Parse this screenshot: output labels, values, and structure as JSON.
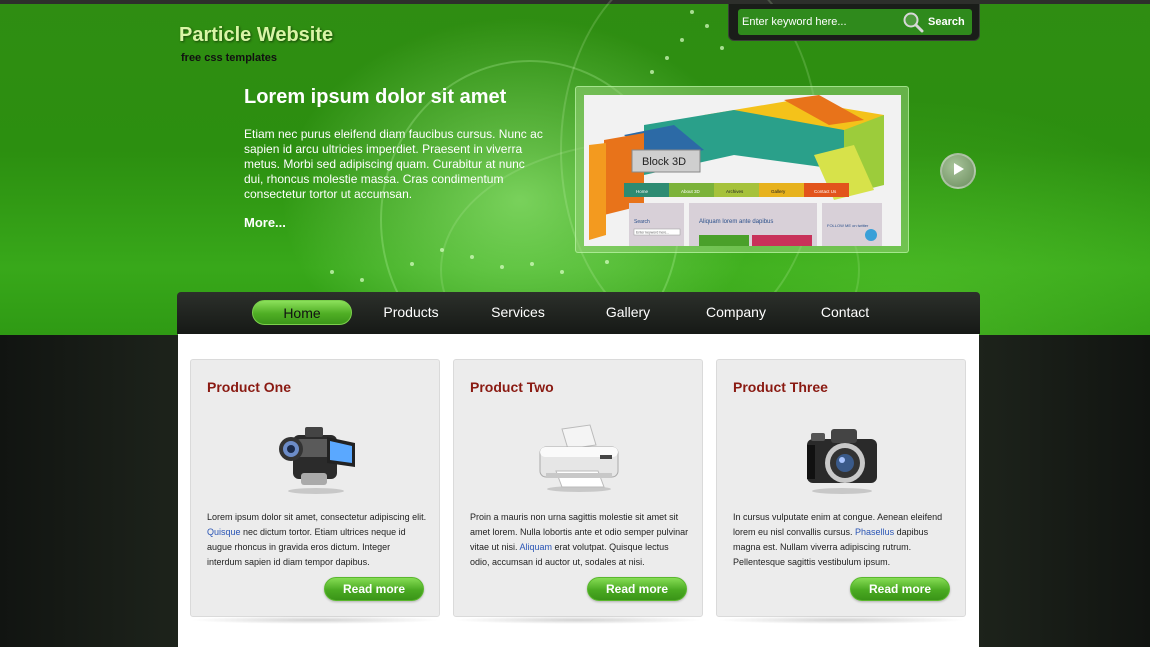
{
  "header": {
    "logo_title": "Particle Website",
    "logo_subtitle": "free css templates",
    "search": {
      "placeholder": "Enter keyword here...",
      "button_label": "Search"
    },
    "intro": {
      "title": "Lorem ipsum dolor sit amet",
      "text": "Etiam nec purus eleifend diam faucibus cursus. Nunc ac sapien id arcu ultricies imperdiet. Praesent in viverra metus. Morbi sed adipiscing quam. Curabitur at nunc dui, rhoncus molestie massa. Cras condimentum consectetur tortor ut accumsan.",
      "more_label": "More..."
    },
    "showcase": {
      "label": "Block 3D",
      "nav": [
        "Home",
        "About 3D",
        "Archives",
        "Gallery",
        "Contact Us"
      ],
      "search_label": "Search",
      "search_placeholder": "Enter keyword here...",
      "post_title": "Aliquam lorem ante dapibus",
      "follow_label": "FOLLOW ME on twitter"
    }
  },
  "nav": {
    "items": [
      {
        "label": "Home",
        "active": true
      },
      {
        "label": "Products"
      },
      {
        "label": "Services"
      },
      {
        "label": "Gallery"
      },
      {
        "label": "Company"
      },
      {
        "label": "Contact"
      }
    ]
  },
  "products": [
    {
      "title": "Product One",
      "icon": "video-camera-icon",
      "text_before": "Lorem ipsum dolor sit amet, consectetur adipiscing elit. ",
      "link": "Quisque",
      "text_after": " nec dictum tortor. Etiam ultrices neque id augue rhoncus in gravida eros dictum. Integer interdum sapien id diam tempor dapibus.",
      "button": "Read more"
    },
    {
      "title": "Product Two",
      "icon": "printer-icon",
      "text_before": "Proin a mauris non urna sagittis molestie sit amet sit amet lorem. Nulla lobortis ante et odio semper pulvinar vitae ut nisi. ",
      "link": "Aliquam",
      "text_after": " erat volutpat. Quisque lectus odio, accumsan id auctor ut, sodales at nisi.",
      "button": "Read more"
    },
    {
      "title": "Product Three",
      "icon": "photo-camera-icon",
      "text_before": "In cursus vulputate enim at congue. Aenean eleifend lorem eu nisl convallis cursus. ",
      "link": "Phasellus",
      "text_after": " dapibus magna est. Nullam viverra adipiscing rutrum. Pellentesque sagittis vestibulum ipsum.",
      "button": "Read more"
    }
  ],
  "colors": {
    "header_green": "#2f8d12",
    "accent_green": "#4aaa22",
    "product_title": "#8a1a12",
    "link_blue": "#2a55b5",
    "nav_dark": "#1a1d19"
  }
}
